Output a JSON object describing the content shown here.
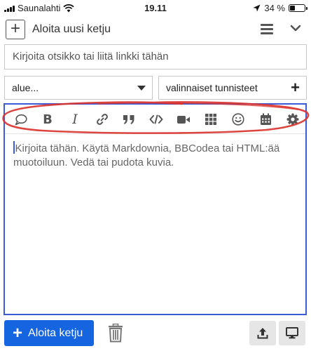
{
  "status_bar": {
    "carrier": "Saunalahti",
    "time": "19.11",
    "battery": "34 %",
    "battery_level": 0.34
  },
  "header": {
    "title": "Aloita uusi ketju"
  },
  "form": {
    "title_placeholder": "Kirjoita otsikko tai liitä linkki tähän",
    "category_value": "alue...",
    "tags_placeholder": "valinnaiset tunnisteet"
  },
  "editor": {
    "placeholder": "Kirjoita tähän. Käytä Markdownia, BBCodea tai HTML:ää muotoiluun. Vedä tai pudota kuvia.",
    "toolbar_icons": [
      "quote-bubble-icon",
      "bold-icon",
      "italic-icon",
      "link-icon",
      "blockquote-icon",
      "code-icon",
      "video-icon",
      "grid-icon",
      "emoji-icon",
      "calendar-icon",
      "gear-icon"
    ]
  },
  "footer": {
    "submit_label": "Aloita ketju"
  },
  "colors": {
    "accent": "#1565e0",
    "editor_border": "#3b5bdb",
    "highlight_annotation": "#d9322b"
  }
}
